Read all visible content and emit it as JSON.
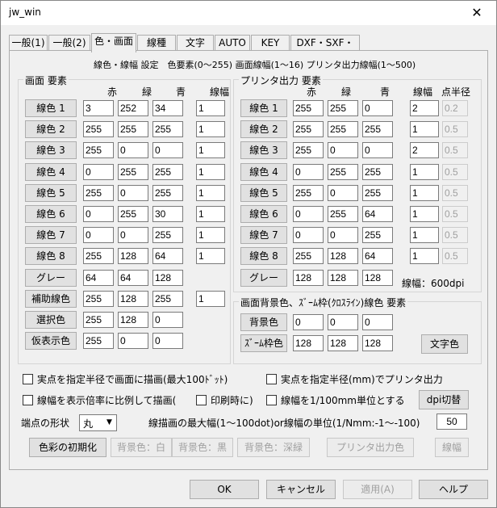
{
  "window": {
    "title": "jw_win",
    "close_glyph": "✕"
  },
  "tabs": [
    {
      "label": "一般(1)"
    },
    {
      "label": "一般(2)"
    },
    {
      "label": "色・画面"
    },
    {
      "label": "線種"
    },
    {
      "label": "文字"
    },
    {
      "label": "AUTO"
    },
    {
      "label": "KEY"
    },
    {
      "label": "DXF・SXF・JWC"
    }
  ],
  "info_line": "線色・線幅 設定　色要素(0〜255)  画面線幅(1〜16)  プリンタ出力線幅(1〜500)",
  "screen": {
    "title": "画面 要素",
    "headers": {
      "r": "赤",
      "g": "緑",
      "b": "青",
      "w": "線幅"
    },
    "rows": [
      {
        "label": "線色 1",
        "r": "3",
        "g": "252",
        "b": "34",
        "w": "1"
      },
      {
        "label": "線色 2",
        "r": "255",
        "g": "255",
        "b": "255",
        "w": "1"
      },
      {
        "label": "線色 3",
        "r": "255",
        "g": "0",
        "b": "0",
        "w": "1"
      },
      {
        "label": "線色 4",
        "r": "0",
        "g": "255",
        "b": "255",
        "w": "1"
      },
      {
        "label": "線色 5",
        "r": "255",
        "g": "0",
        "b": "255",
        "w": "1"
      },
      {
        "label": "線色 6",
        "r": "0",
        "g": "255",
        "b": "30",
        "w": "1"
      },
      {
        "label": "線色 7",
        "r": "0",
        "g": "0",
        "b": "255",
        "w": "1"
      },
      {
        "label": "線色 8",
        "r": "255",
        "g": "128",
        "b": "64",
        "w": "1"
      },
      {
        "label": "グレー",
        "r": "64",
        "g": "64",
        "b": "128",
        "w": ""
      },
      {
        "label": "補助線色",
        "r": "255",
        "g": "128",
        "b": "255",
        "w": "1"
      },
      {
        "label": "選択色",
        "r": "255",
        "g": "128",
        "b": "0",
        "w": ""
      },
      {
        "label": "仮表示色",
        "r": "255",
        "g": "0",
        "b": "0",
        "w": ""
      }
    ]
  },
  "printer": {
    "title": "プリンタ出力 要素",
    "headers": {
      "r": "赤",
      "g": "緑",
      "b": "青",
      "w": "線幅",
      "p": "点半径"
    },
    "rows": [
      {
        "label": "線色 1",
        "r": "255",
        "g": "255",
        "b": "0",
        "w": "2",
        "p": "0.2"
      },
      {
        "label": "線色 2",
        "r": "255",
        "g": "255",
        "b": "255",
        "w": "1",
        "p": "0.5"
      },
      {
        "label": "線色 3",
        "r": "255",
        "g": "0",
        "b": "0",
        "w": "2",
        "p": "0.5"
      },
      {
        "label": "線色 4",
        "r": "0",
        "g": "255",
        "b": "255",
        "w": "1",
        "p": "0.5"
      },
      {
        "label": "線色 5",
        "r": "255",
        "g": "0",
        "b": "255",
        "w": "1",
        "p": "0.5"
      },
      {
        "label": "線色 6",
        "r": "0",
        "g": "255",
        "b": "64",
        "w": "1",
        "p": "0.5"
      },
      {
        "label": "線色 7",
        "r": "0",
        "g": "0",
        "b": "255",
        "w": "1",
        "p": "0.5"
      },
      {
        "label": "線色 8",
        "r": "255",
        "g": "128",
        "b": "64",
        "w": "1",
        "p": "0.5"
      },
      {
        "label": "グレー",
        "r": "128",
        "g": "128",
        "b": "128",
        "w": "",
        "p": ""
      }
    ],
    "dpi_note": "線幅：600dpi"
  },
  "bg": {
    "title": "画面背景色、ｽﾞｰﾑ枠(ｸﾛｽﾗｲﾝ)線色 要素",
    "rows": [
      {
        "label": "背景色",
        "r": "0",
        "g": "0",
        "b": "0"
      },
      {
        "label": "ｽﾞｰﾑ枠色",
        "r": "128",
        "g": "128",
        "b": "128"
      }
    ],
    "text_color_button": "文字色"
  },
  "options": {
    "point_radius_screen": "実点を指定半径で画面に描画(最大100ﾄﾞｯﾄ)",
    "point_radius_printer": "実点を指定半径(mm)でプリンタ出力",
    "line_width_scale": "線幅を表示倍率に比例して描画(",
    "print_time": "印刷時に)",
    "line_width_unit": "線幅を1/100mm単位とする",
    "dpi_button": "dpi切替",
    "endpoint_label": "端点の形状",
    "endpoint_value": "丸",
    "max_width_label": "線描画の最大幅(1〜100dot)or線幅の単位(1/Nmm:-1〜-100)",
    "max_width_value": "50"
  },
  "bottom_buttons": {
    "init": "色彩の初期化",
    "bg_white": "背景色：白",
    "bg_black": "背景色：黒",
    "bg_deepgreen": "背景色：深緑",
    "printer_color": "プリンタ出力色",
    "line_width": "線幅"
  },
  "dialog_buttons": {
    "ok": "OK",
    "cancel": "キャンセル",
    "apply": "適用(A)",
    "help": "ヘルプ"
  }
}
